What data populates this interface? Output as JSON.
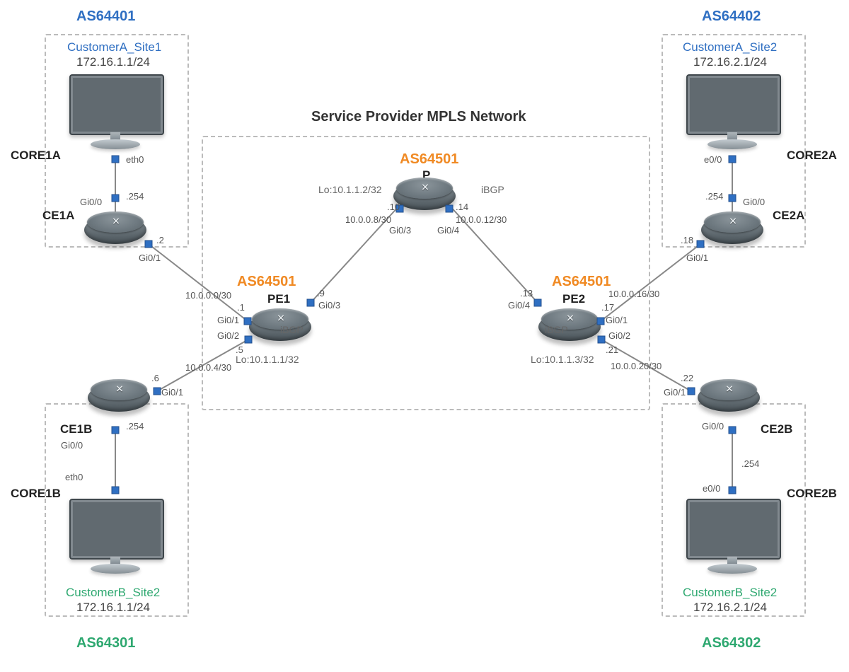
{
  "title": "Service Provider MPLS Network",
  "as": {
    "tl": "AS64401",
    "tr": "AS64402",
    "bl": "AS64301",
    "br": "AS64302",
    "sp": "AS64501"
  },
  "sites": {
    "tl_name": "CustomerA_Site1",
    "tl_sub": "172.16.1.1/24",
    "tr_name": "CustomerA_Site2",
    "tr_sub": "172.16.2.1/24",
    "bl_name": "CustomerB_Site2",
    "bl_sub": "172.16.1.1/24",
    "br_name": "CustomerB_Site2",
    "br_sub": "172.16.2.1/24"
  },
  "hosts": {
    "tl": "CORE1A",
    "tr": "CORE2A",
    "bl": "CORE1B",
    "br": "CORE2B"
  },
  "ce": {
    "a1": "CE1A",
    "a2": "CE2A",
    "b1": "CE1B",
    "b2": "CE2B"
  },
  "sp": {
    "pe1": {
      "name": "PE1",
      "lo": "Lo:10.1.1.1/32",
      "bgp": "iBGP"
    },
    "pe2": {
      "name": "PE2",
      "lo": "Lo:10.1.1.3/32",
      "bgp": "iBGP"
    },
    "p": {
      "name": "P",
      "lo": "Lo:10.1.1.2/32",
      "bgp": "iBGP"
    }
  },
  "ifs": {
    "eth0": "eth0",
    "e00": "e0/0",
    "gi00": "Gi0/0",
    "gi01": "Gi0/1",
    "gi02": "Gi0/2",
    "gi03": "Gi0/3",
    "gi04": "Gi0/4"
  },
  "nets": {
    "n0": "10.0.0.0/30",
    "n4": "10.0.0.4/30",
    "n8": "10.0.0.8/30",
    "n12": "10.0.0.12/30",
    "n16": "10.0.0.16/30",
    "n20": "10.0.0.20/30"
  },
  "ips": {
    "p1": ".1",
    "p2": ".2",
    "p5": ".5",
    "p6": ".6",
    "p9": ".9",
    "p10": ".10",
    "p13": ".13",
    "p14": ".14",
    "p17": ".17",
    "p18": ".18",
    "p21": ".21",
    "p22": ".22",
    "p254": ".254"
  }
}
